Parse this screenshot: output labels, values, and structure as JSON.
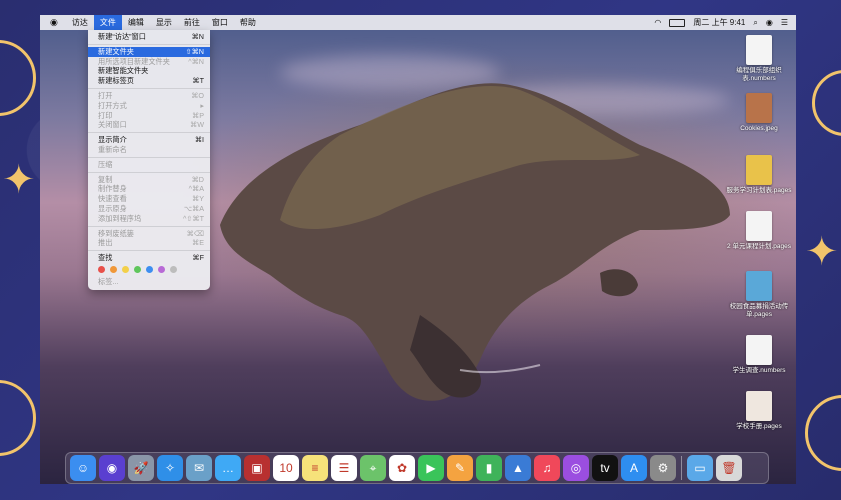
{
  "menubar": {
    "apple": "",
    "items": [
      "访达",
      "文件",
      "编辑",
      "显示",
      "前往",
      "窗口",
      "帮助"
    ],
    "active_index": 1,
    "clock": "周二 上午 9:41"
  },
  "file_menu": {
    "items": [
      {
        "label": "新建“访达”窗口",
        "shortcut": "⌘N",
        "state": "normal"
      },
      {
        "label": "新建文件夹",
        "shortcut": "⇧⌘N",
        "state": "highlighted"
      },
      {
        "label": "用所选项目新建文件夹",
        "shortcut": "^⌘N",
        "state": "disabled"
      },
      {
        "label": "新建智能文件夹",
        "shortcut": "",
        "state": "normal"
      },
      {
        "label": "新建标签页",
        "shortcut": "⌘T",
        "state": "normal"
      },
      {
        "label": "打开",
        "shortcut": "⌘O",
        "state": "disabled"
      },
      {
        "label": "打开方式",
        "shortcut": "▸",
        "state": "disabled"
      },
      {
        "label": "打印",
        "shortcut": "⌘P",
        "state": "disabled"
      },
      {
        "label": "关闭窗口",
        "shortcut": "⌘W",
        "state": "disabled"
      },
      {
        "label": "显示简介",
        "shortcut": "⌘I",
        "state": "normal"
      },
      {
        "label": "重新命名",
        "shortcut": "",
        "state": "disabled"
      },
      {
        "label": "压缩",
        "shortcut": "",
        "state": "disabled"
      },
      {
        "label": "复制",
        "shortcut": "⌘D",
        "state": "disabled"
      },
      {
        "label": "制作替身",
        "shortcut": "^⌘A",
        "state": "disabled"
      },
      {
        "label": "快速查看",
        "shortcut": "⌘Y",
        "state": "disabled"
      },
      {
        "label": "显示原身",
        "shortcut": "⌥⌘A",
        "state": "disabled"
      },
      {
        "label": "添加到程序坞",
        "shortcut": "^⇧⌘T",
        "state": "disabled"
      },
      {
        "label": "移到废纸篓",
        "shortcut": "⌘⌫",
        "state": "disabled"
      },
      {
        "label": "推出",
        "shortcut": "⌘E",
        "state": "disabled"
      },
      {
        "label": "查找",
        "shortcut": "⌘F",
        "state": "normal"
      },
      {
        "label": "标签...",
        "shortcut": "",
        "state": "disabled"
      }
    ],
    "tag_colors": [
      "#e8504a",
      "#f0983a",
      "#f3d04a",
      "#5fc65c",
      "#3d8ef0",
      "#b86ad6",
      "#bdbdbd"
    ]
  },
  "desktop_icons": [
    {
      "name": "编程俱乐部组织表.numbers",
      "icon": "numbers-doc-icon",
      "color": "#f4f4f4"
    },
    {
      "name": "Cookies.jpeg",
      "icon": "jpeg-image-icon",
      "color": "#b8734a"
    },
    {
      "name": "服务学习计划表.pages",
      "icon": "pages-doc-icon",
      "color": "#e9c24a"
    },
    {
      "name": "2 单元课程计划.pages",
      "icon": "pages-doc-icon",
      "color": "#f4f4f4"
    },
    {
      "name": "校园食品募捐活动传单.pages",
      "icon": "pages-doc-icon",
      "color": "#5aa8d8"
    },
    {
      "name": "学生调查.numbers",
      "icon": "numbers-doc-icon",
      "color": "#f4f4f4"
    },
    {
      "name": "学校手册.pages",
      "icon": "pages-doc-icon",
      "color": "#efe7df"
    }
  ],
  "dock": {
    "apps": [
      {
        "name": "finder",
        "icon": "finder-icon",
        "color": "#3b8ef0",
        "glyph": "☺"
      },
      {
        "name": "siri",
        "icon": "siri-icon",
        "color": "#5a3fd0",
        "glyph": "◉"
      },
      {
        "name": "launchpad",
        "icon": "launchpad-icon",
        "color": "#8a96a8",
        "glyph": "🚀"
      },
      {
        "name": "safari",
        "icon": "safari-icon",
        "color": "#2f8fe8",
        "glyph": "✧"
      },
      {
        "name": "mail-photo",
        "icon": "preview-icon",
        "color": "#6aa0c8",
        "glyph": "✉"
      },
      {
        "name": "messages",
        "icon": "messages-icon",
        "color": "#3fa9f5",
        "glyph": "…"
      },
      {
        "name": "photo-booth",
        "icon": "photo-booth-icon",
        "color": "#b83030",
        "glyph": "▣"
      },
      {
        "name": "calendar",
        "icon": "calendar-icon",
        "color": "#ffffff",
        "glyph": "10"
      },
      {
        "name": "notes",
        "icon": "notes-icon",
        "color": "#f6e27a",
        "glyph": "≡"
      },
      {
        "name": "reminders",
        "icon": "reminders-icon",
        "color": "#ffffff",
        "glyph": "☰"
      },
      {
        "name": "maps",
        "icon": "maps-icon",
        "color": "#6cc36a",
        "glyph": "⌖"
      },
      {
        "name": "photos",
        "icon": "photos-icon",
        "color": "#ffffff",
        "glyph": "✿"
      },
      {
        "name": "facetime",
        "icon": "facetime-icon",
        "color": "#3ac45a",
        "glyph": "▶"
      },
      {
        "name": "pages",
        "icon": "pages-app-icon",
        "color": "#f4a340",
        "glyph": "✎"
      },
      {
        "name": "numbers",
        "icon": "numbers-app-icon",
        "color": "#3fb35a",
        "glyph": "▮"
      },
      {
        "name": "keynote",
        "icon": "keynote-app-icon",
        "color": "#3a7bd5",
        "glyph": "▲"
      },
      {
        "name": "music",
        "icon": "music-icon",
        "color": "#f0485a",
        "glyph": "♫"
      },
      {
        "name": "podcasts",
        "icon": "podcasts-icon",
        "color": "#9b4ee0",
        "glyph": "◎"
      },
      {
        "name": "tv",
        "icon": "tv-icon",
        "color": "#111111",
        "glyph": "tv"
      },
      {
        "name": "app-store",
        "icon": "app-store-icon",
        "color": "#2e8ef0",
        "glyph": "A"
      },
      {
        "name": "system-preferences",
        "icon": "gear-icon",
        "color": "#8a8a8a",
        "glyph": "⚙"
      }
    ],
    "right": [
      {
        "name": "downloads",
        "icon": "folder-icon",
        "color": "#5aa8e8",
        "glyph": "▭"
      },
      {
        "name": "trash",
        "icon": "trash-icon",
        "color": "#d8d8d8",
        "glyph": "🗑"
      }
    ]
  }
}
